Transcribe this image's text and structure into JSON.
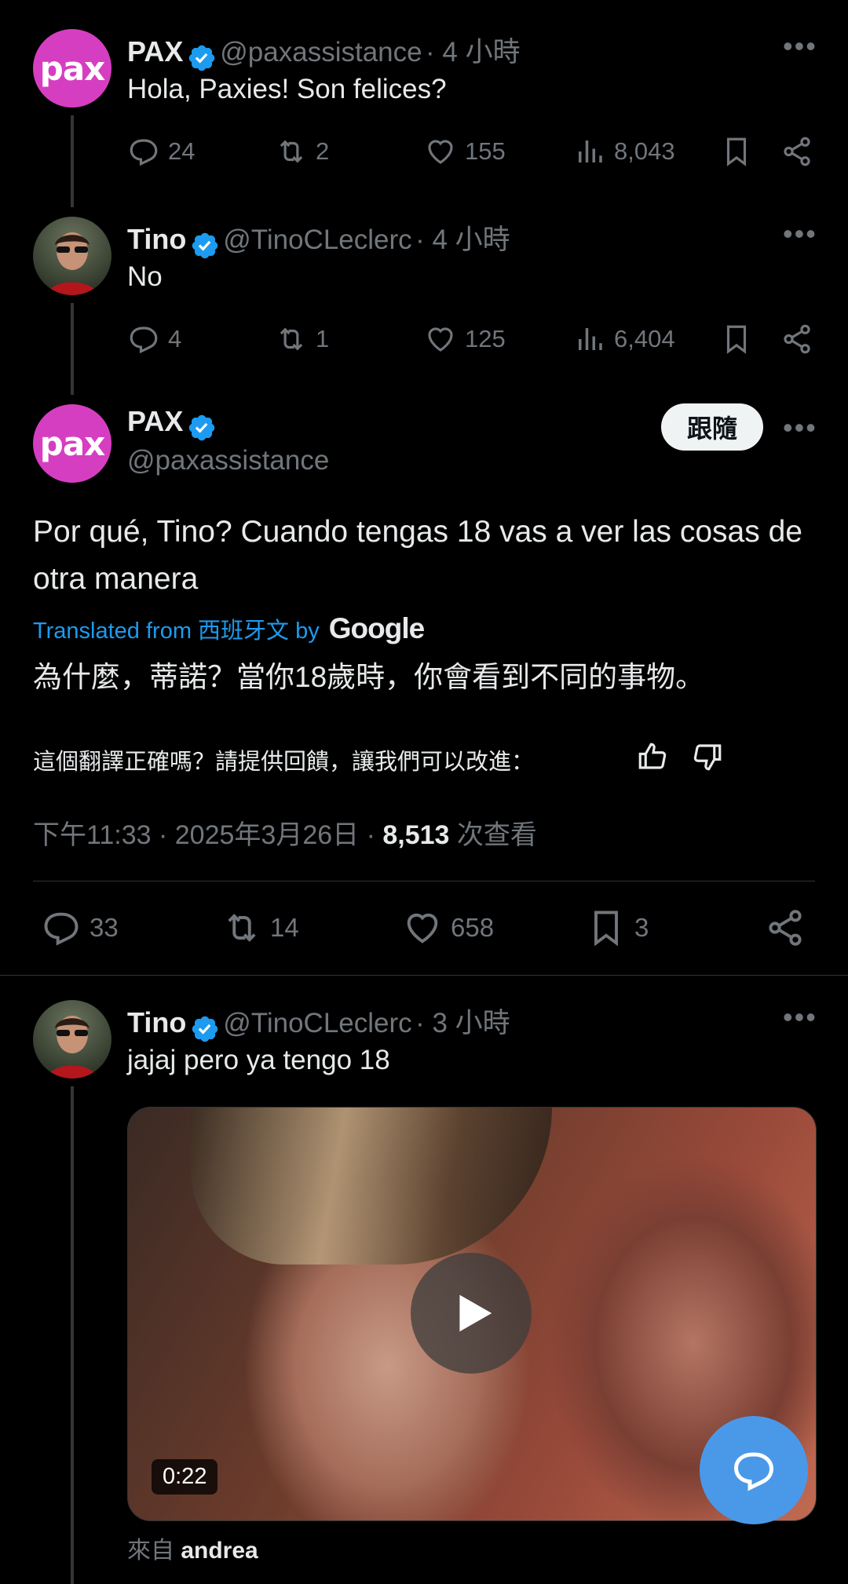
{
  "tweet1": {
    "name": "PAX",
    "handle": "@paxassistance",
    "time": "· 4 小時",
    "text": "Hola, Paxies! Son felices?",
    "replies": "24",
    "retweets": "2",
    "likes": "155",
    "views": "8,043",
    "avatar_text": "pax"
  },
  "tweet2": {
    "name": "Tino",
    "handle": "@TinoCLeclerc",
    "time": "· 4 小時",
    "text": "No",
    "replies": "4",
    "retweets": "1",
    "likes": "125",
    "views": "6,404"
  },
  "main": {
    "name": "PAX",
    "handle": "@paxassistance",
    "follow_label": "跟隨",
    "text": "Por qué, Tino? Cuando tengas 18 vas a ver las cosas de otra manera",
    "translated_prefix": "Translated from 西班牙文 by",
    "google": "Google",
    "translation": "為什麼，蒂諾？當你18歲時，你會看到不同的事物。",
    "feedback": "這個翻譯正確嗎？請提供回饋，讓我們可以改進：",
    "timestamp": "下午11:33 · 2025年3月26日 ·",
    "views_count": "8,513",
    "views_label": "次查看",
    "replies": "33",
    "retweets": "14",
    "likes": "658",
    "bookmarks": "3",
    "avatar_text": "pax"
  },
  "reply": {
    "name": "Tino",
    "handle": "@TinoCLeclerc",
    "time": "· 3 小時",
    "text": "jajaj pero ya tengo 18",
    "duration": "0:22",
    "from_prefix": "來自",
    "from_user": "andrea"
  },
  "colors": {
    "accent": "#1d9bf0",
    "avatar_pax": "#d63ec1",
    "fab": "#4a99e9",
    "muted": "#71767b"
  }
}
